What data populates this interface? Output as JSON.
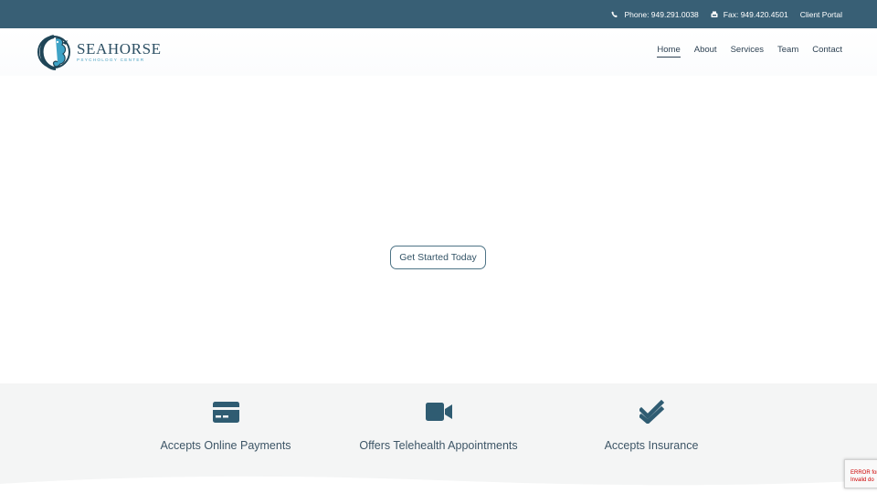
{
  "topbar": {
    "phone": "Phone: 949.291.0038",
    "fax": "Fax: 949.420.4501",
    "portal": "Client Portal"
  },
  "logo": {
    "name": "SEAHORSE",
    "sub": "PSYCHOLOGY CENTER"
  },
  "nav": {
    "items": [
      "Home",
      "About",
      "Services",
      "Team",
      "Contact"
    ],
    "active": "Home"
  },
  "hero": {
    "cta": "Get Started Today"
  },
  "features": [
    {
      "icon": "credit-card-icon",
      "label": "Accepts Online Payments"
    },
    {
      "icon": "video-camera-icon",
      "label": "Offers Telehealth Appointments"
    },
    {
      "icon": "double-check-icon",
      "label": "Accepts Insurance"
    }
  ],
  "recaptcha": {
    "line1": "ERROR for",
    "line2": "Invalid do"
  },
  "colors": {
    "topbar": "#385f75",
    "accent": "#2f5c72",
    "features_bg": "#f4f5f5"
  }
}
